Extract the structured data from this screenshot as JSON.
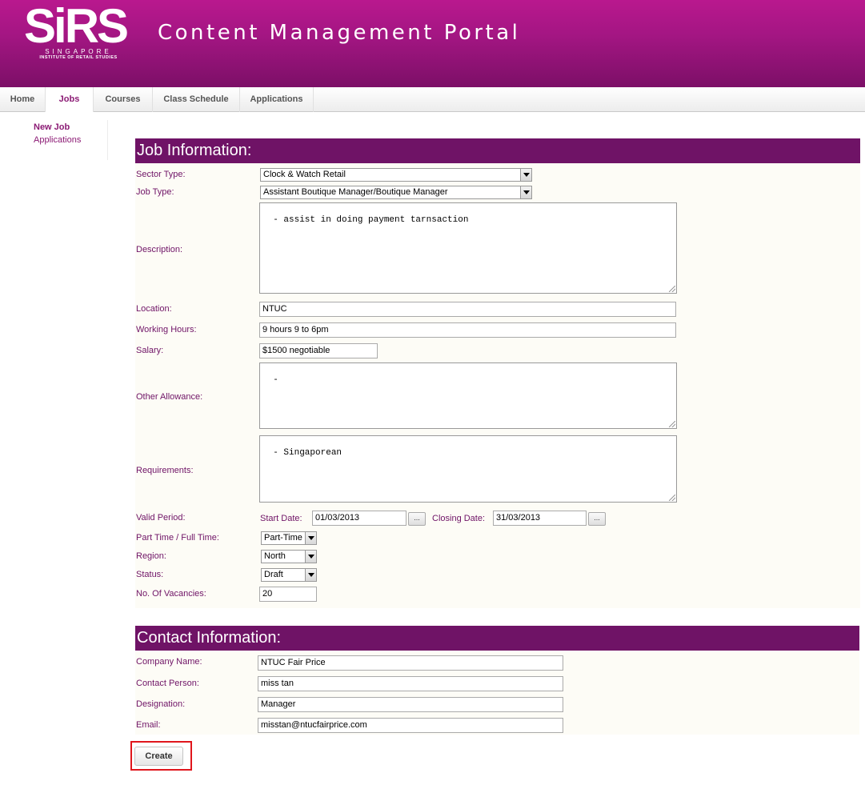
{
  "header": {
    "logo_text": "SiRS",
    "logo_sub1": "SINGAPORE",
    "logo_sub2": "INSTITUTE OF RETAIL STUDIES",
    "title": "Content Management Portal"
  },
  "nav": {
    "items": [
      {
        "label": "Home",
        "active": false
      },
      {
        "label": "Jobs",
        "active": true
      },
      {
        "label": "Courses",
        "active": false
      },
      {
        "label": "Class Schedule",
        "active": false
      },
      {
        "label": "Applications",
        "active": false
      }
    ]
  },
  "sidebar": {
    "items": [
      {
        "label": "New Job",
        "active": true
      },
      {
        "label": "Applications",
        "active": false
      }
    ]
  },
  "job_info": {
    "title": "Job Information:",
    "sector_type": {
      "label": "Sector Type:",
      "value": "Clock & Watch Retail"
    },
    "job_type": {
      "label": "Job Type:",
      "value": "Assistant Boutique Manager/Boutique Manager"
    },
    "description": {
      "label": "Description:",
      "value": "- assist in doing payment tarnsaction"
    },
    "location": {
      "label": "Location:",
      "value": "NTUC"
    },
    "working_hours": {
      "label": "Working Hours:",
      "value": "9 hours 9 to 6pm"
    },
    "salary": {
      "label": "Salary:",
      "value": "$1500 negotiable"
    },
    "other_allowance": {
      "label": "Other Allowance:",
      "value": "-"
    },
    "requirements": {
      "label": "Requirements:",
      "value": "- Singaporean"
    },
    "valid_period": {
      "label": "Valid Period:",
      "start_label": "Start Date:",
      "start_value": "01/03/2013",
      "closing_label": "Closing Date:",
      "closing_value": "31/03/2013",
      "picker_label": "..."
    },
    "part_full": {
      "label": "Part Time / Full Time:",
      "value": "Part-Time"
    },
    "region": {
      "label": "Region:",
      "value": "North"
    },
    "status": {
      "label": "Status:",
      "value": "Draft"
    },
    "vacancies": {
      "label": "No. Of Vacancies:",
      "value": "20"
    }
  },
  "contact_info": {
    "title": "Contact Information:",
    "company": {
      "label": "Company Name:",
      "value": "NTUC Fair Price"
    },
    "contact_person": {
      "label": "Contact Person:",
      "value": "miss tan"
    },
    "designation": {
      "label": "Designation:",
      "value": "Manager"
    },
    "email": {
      "label": "Email:",
      "value": "misstan@ntucfairprice.com"
    }
  },
  "actions": {
    "create_label": "Create"
  },
  "colors": {
    "header_top": "#b9188e",
    "header_bottom": "#7c0f67",
    "section_header": "#6f1366",
    "label_text": "#6f1366",
    "highlight": "#e0161c"
  }
}
